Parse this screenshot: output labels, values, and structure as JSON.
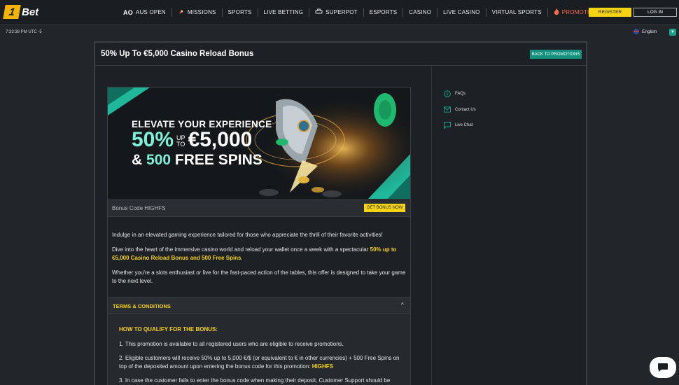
{
  "header": {
    "logo_number": "1",
    "logo_text": "Bet",
    "nav": [
      {
        "label": "AUS OPEN",
        "icon": "ao-logo-icon"
      },
      {
        "label": "MISSIONS",
        "icon": "rocket-icon"
      },
      {
        "label": "SPORTS"
      },
      {
        "label": "LIVE BETTING"
      },
      {
        "label": "SUPERPOT",
        "icon": "car-icon"
      },
      {
        "label": "ESPORTS"
      },
      {
        "label": "CASINO"
      },
      {
        "label": "LIVE CASINO"
      },
      {
        "label": "VIRTUAL SPORTS"
      },
      {
        "label": "PROMOTIONS",
        "icon": "fire-icon"
      }
    ],
    "ao_mark": "AO",
    "register_label": "REGISTER",
    "login_label": "LOG IN"
  },
  "status": {
    "time": "7:33:38 PM UTC -5",
    "language": "English"
  },
  "page": {
    "title": "50% Up To €5,000 Casino Reload Bonus",
    "back_label": "BACK TO PROMOTIONS"
  },
  "banner": {
    "line1": "ELEVATE YOUR EXPERIENCE",
    "percent": "50%",
    "up": "UP",
    "to": "TO",
    "amount": "€5,000",
    "amp": "&",
    "spins_count": "500",
    "spins_text": "FREE SPINS"
  },
  "bonus": {
    "code_text": "Bonus Code HIGHFS",
    "get_label": "GET BONUS NOW"
  },
  "description": {
    "p1": "Indulge in an elevated gaming experience tailored for those who appreciate the thrill of their favorite activities!",
    "p2_start": "Dive into the heart of the immersive casino world and reload your wallet once a week with a spectacular ",
    "p2_highlight": "50% up to €5,000 Casino Reload Bonus and 500 Free Spins",
    "p2_end": ".",
    "p3": "Whether you're a slots enthusiast or live for the fast-paced action of the tables, this offer is designed to take your game to the next level."
  },
  "terms": {
    "label": "TERMS & CONDITIONS",
    "qualify_title": "HOW TO QUALIFY FOR THE BONUS:",
    "item1": "1. This promotion is available to all registered users who are eligible to receive promotions.",
    "item2_start": "2. Eligible customers will receive 50% up to 5,000 €/$ (or equivalent to € in other currencies) + 500 Free Spins on top of the deposited amount upon entering the bonus code for this promotion: ",
    "item2_code": "HIGHFS",
    "item3": "3. In case the customer fails to enter the bonus code when making their deposit, Customer Support should be"
  },
  "side_links": [
    {
      "label": "FAQs",
      "icon": "info-icon"
    },
    {
      "label": "Contact Us",
      "icon": "mail-icon"
    },
    {
      "label": "Live Chat",
      "icon": "chat-icon"
    }
  ],
  "colors": {
    "accent_yellow": "#f6d313",
    "accent_teal": "#14907e",
    "promo_red": "#ff6b4a",
    "background": "#22262a"
  }
}
